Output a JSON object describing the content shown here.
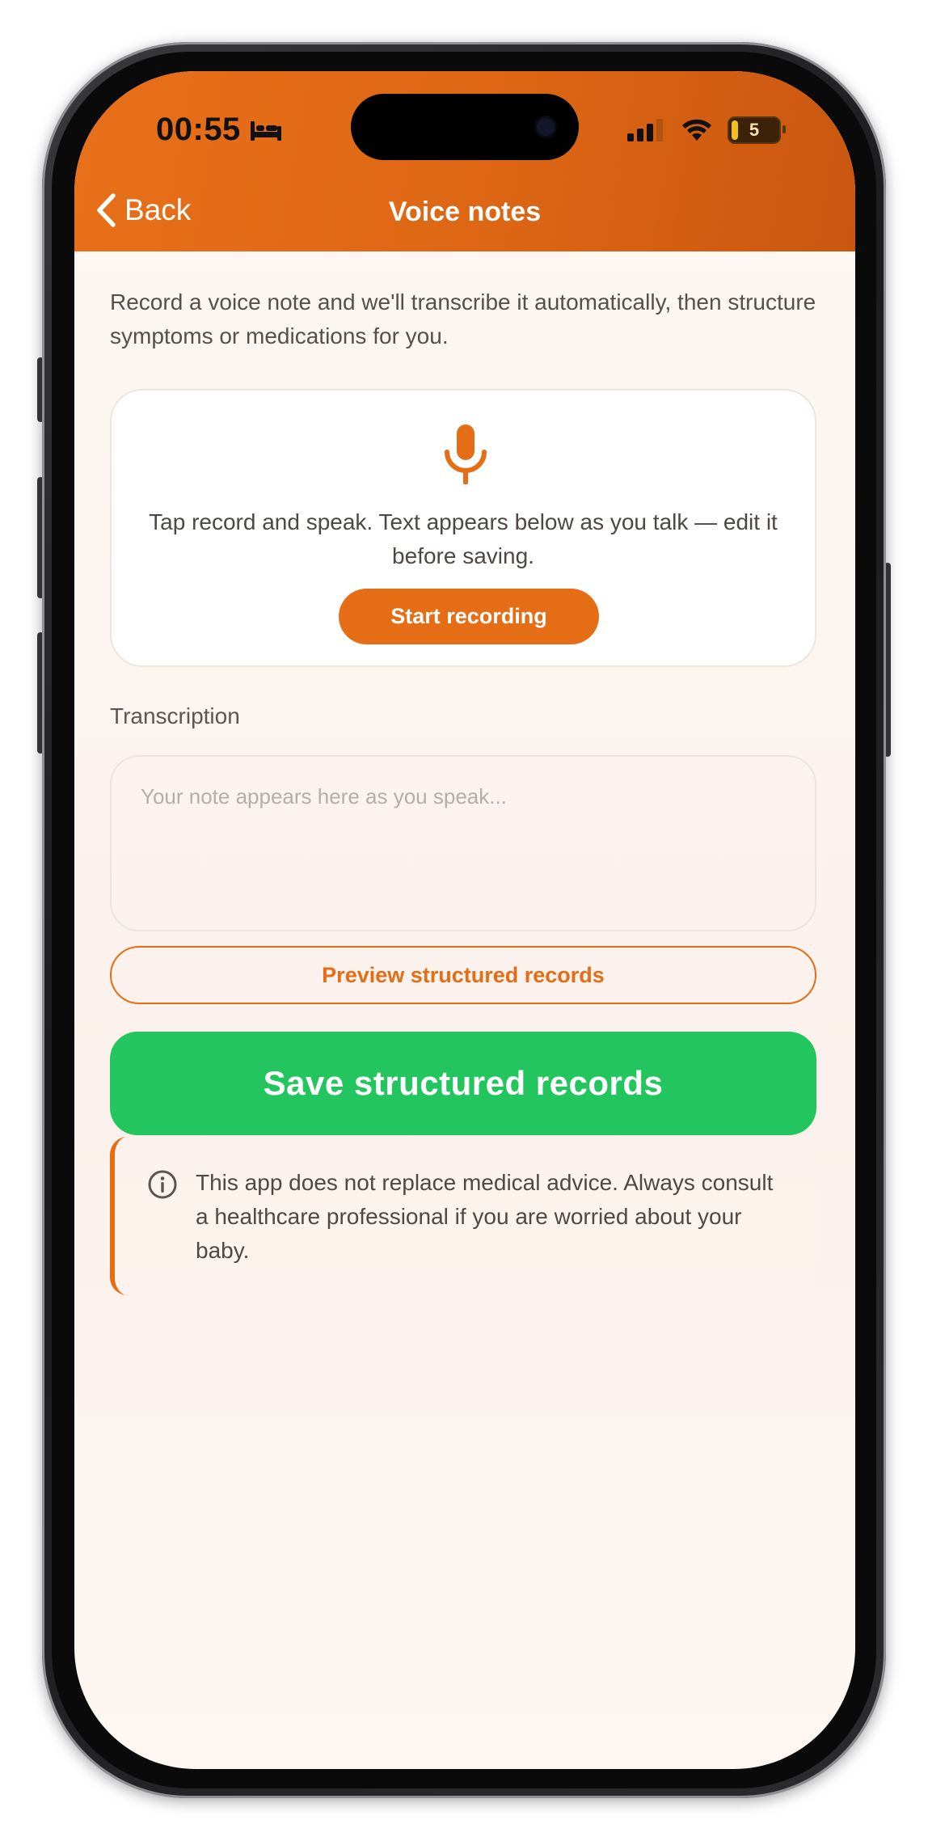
{
  "status_bar": {
    "time": "00:55",
    "battery": "5"
  },
  "nav": {
    "back_label": "Back",
    "title": "Voice notes"
  },
  "intro_text": "Record a voice note and we'll transcribe it automatically, then structure symptoms or medications for you.",
  "record_card": {
    "hint": "Tap record and speak. Text appears below as you talk — edit it before saving.",
    "button_label": "Start recording"
  },
  "transcription": {
    "label": "Transcription",
    "value": "",
    "placeholder": "Your note appears here as you speak..."
  },
  "actions": {
    "preview_label": "Preview structured records",
    "save_label": "Save structured records"
  },
  "disclaimer": {
    "text": "This app does not replace medical advice. Always consult a healthcare professional if you are worried about your baby."
  },
  "colors": {
    "accent": "#e46d15",
    "header": "#dd6614",
    "save": "#22c55e",
    "background": "#fdf8f4"
  },
  "icons": {
    "status_mode": "bed-icon",
    "signal": "cellular-signal-icon",
    "wifi": "wifi-icon",
    "back": "chevron-left-icon",
    "record": "microphone-icon",
    "info": "info-circle-icon"
  }
}
